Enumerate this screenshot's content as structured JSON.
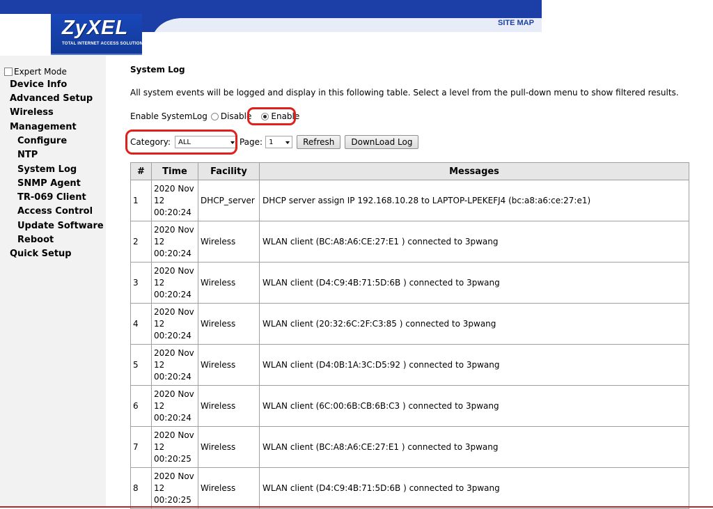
{
  "header": {
    "brand": "ZyXEL",
    "tagline": "TOTAL INTERNET ACCESS SOLUTION",
    "site_map": "SITE MAP",
    "colors": {
      "brand_blue": "#1b3fa6",
      "highlight_red": "#e0201b"
    }
  },
  "sidebar": {
    "expert_mode": "Expert Mode",
    "items": [
      {
        "label": "Device Info"
      },
      {
        "label": "Advanced Setup"
      },
      {
        "label": "Wireless"
      },
      {
        "label": "Management"
      },
      {
        "label": "Configure"
      },
      {
        "label": "NTP"
      },
      {
        "label": "System Log"
      },
      {
        "label": "SNMP Agent"
      },
      {
        "label": "TR-069 Client"
      },
      {
        "label": "Access Control"
      },
      {
        "label": "Update Software"
      },
      {
        "label": "Reboot"
      },
      {
        "label": "Quick Setup"
      }
    ]
  },
  "main": {
    "title": "System Log",
    "intro": "All system events will be logged and display in this following table. Select a level from the pull-down menu to show filtered results.",
    "enable_label": "Enable SystemLog",
    "disable_option": "Disable",
    "enable_option": "Enable",
    "category_label": "Category:",
    "category_value": "ALL",
    "page_label": "Page:",
    "page_value": "1",
    "refresh_button": "Refresh",
    "download_button": "DownLoad Log"
  },
  "table": {
    "headers": [
      "#",
      "Time",
      "Facility",
      "Messages"
    ],
    "rows": [
      {
        "num": "1",
        "time": [
          "2020 Nov",
          "12",
          "00:20:24"
        ],
        "facility": "DHCP_server",
        "message": "DHCP server assign IP 192.168.10.28 to LAPTOP-LPEKEFJ4 (bc:a8:a6:ce:27:e1)"
      },
      {
        "num": "2",
        "time": [
          "2020 Nov",
          "12",
          "00:20:24"
        ],
        "facility": "Wireless",
        "message": "WLAN client (BC:A8:A6:CE:27:E1 ) connected to 3pwang"
      },
      {
        "num": "3",
        "time": [
          "2020 Nov",
          "12",
          "00:20:24"
        ],
        "facility": "Wireless",
        "message": "WLAN client (D4:C9:4B:71:5D:6B ) connected to 3pwang"
      },
      {
        "num": "4",
        "time": [
          "2020 Nov",
          "12",
          "00:20:24"
        ],
        "facility": "Wireless",
        "message": "WLAN client (20:32:6C:2F:C3:85 ) connected to 3pwang"
      },
      {
        "num": "5",
        "time": [
          "2020 Nov",
          "12",
          "00:20:24"
        ],
        "facility": "Wireless",
        "message": "WLAN client (D4:0B:1A:3C:D5:92 ) connected to 3pwang"
      },
      {
        "num": "6",
        "time": [
          "2020 Nov",
          "12",
          "00:20:24"
        ],
        "facility": "Wireless",
        "message": "WLAN client (6C:00:6B:CB:6B:C3 ) connected to 3pwang"
      },
      {
        "num": "7",
        "time": [
          "2020 Nov",
          "12",
          "00:20:25"
        ],
        "facility": "Wireless",
        "message": "WLAN client (BC:A8:A6:CE:27:E1 ) connected to 3pwang"
      },
      {
        "num": "8",
        "time": [
          "2020 Nov",
          "12",
          "00:20:25"
        ],
        "facility": "Wireless",
        "message": "WLAN client (D4:C9:4B:71:5D:6B ) connected to 3pwang"
      }
    ]
  }
}
